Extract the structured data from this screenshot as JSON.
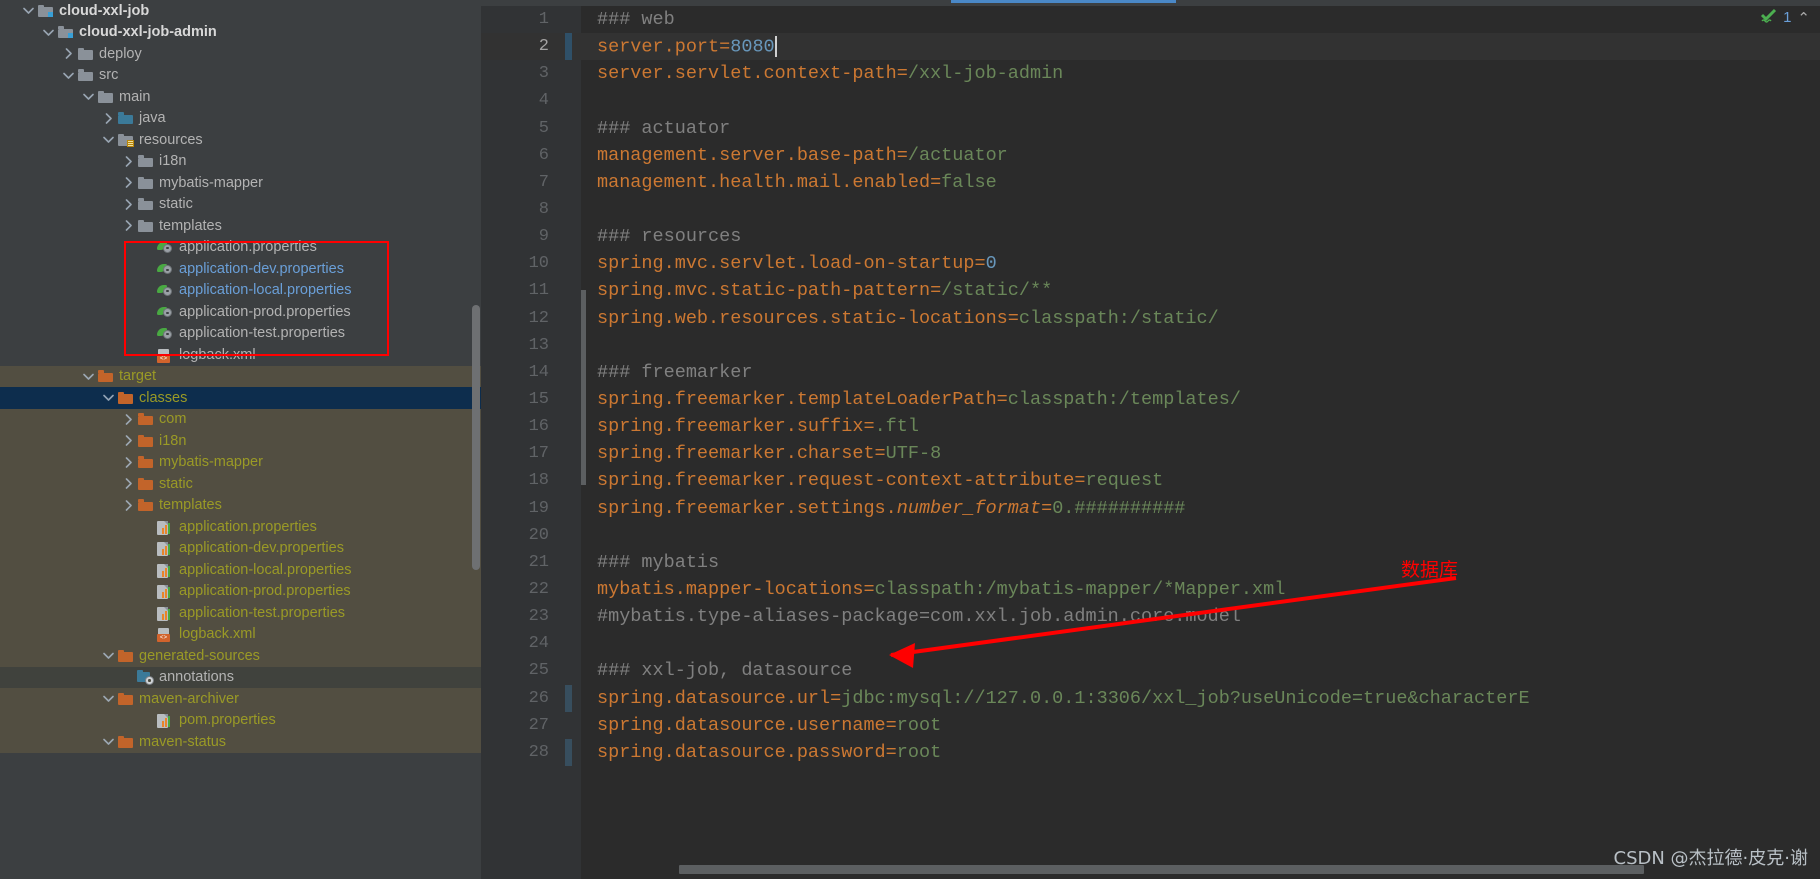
{
  "sidebar": {
    "scrollbar_label": "project-tree-scrollbar",
    "items": [
      {
        "label": "cloud-xxl-job",
        "indent": 0,
        "arrow": "down",
        "icon": "module-folder-icon",
        "style": "bold",
        "state": "normal"
      },
      {
        "label": "cloud-xxl-job-admin",
        "indent": 1,
        "arrow": "down",
        "icon": "module-folder-icon",
        "style": "bold",
        "state": "normal"
      },
      {
        "label": "deploy",
        "indent": 2,
        "arrow": "right",
        "icon": "folder-icon",
        "style": "grey",
        "state": "normal"
      },
      {
        "label": "src",
        "indent": 2,
        "arrow": "down",
        "icon": "folder-icon",
        "style": "grey",
        "state": "normal"
      },
      {
        "label": "main",
        "indent": 3,
        "arrow": "down",
        "icon": "folder-icon",
        "style": "grey",
        "state": "normal"
      },
      {
        "label": "java",
        "indent": 4,
        "arrow": "right",
        "icon": "source-folder-icon",
        "style": "grey",
        "state": "normal"
      },
      {
        "label": "resources",
        "indent": 4,
        "arrow": "down",
        "icon": "resources-folder-icon",
        "style": "grey",
        "state": "normal"
      },
      {
        "label": "i18n",
        "indent": 5,
        "arrow": "right",
        "icon": "folder-icon",
        "style": "grey",
        "state": "normal"
      },
      {
        "label": "mybatis-mapper",
        "indent": 5,
        "arrow": "right",
        "icon": "folder-icon",
        "style": "grey",
        "state": "normal"
      },
      {
        "label": "static",
        "indent": 5,
        "arrow": "right",
        "icon": "folder-icon",
        "style": "grey",
        "state": "normal"
      },
      {
        "label": "templates",
        "indent": 5,
        "arrow": "right",
        "icon": "folder-icon",
        "style": "grey",
        "state": "normal"
      },
      {
        "label": "application.properties",
        "indent": 6,
        "arrow": "none",
        "icon": "spring-properties-icon",
        "style": "grey",
        "state": "normal"
      },
      {
        "label": "application-dev.properties",
        "indent": 6,
        "arrow": "none",
        "icon": "spring-properties-icon",
        "style": "blue",
        "state": "normal"
      },
      {
        "label": "application-local.properties",
        "indent": 6,
        "arrow": "none",
        "icon": "spring-properties-icon",
        "style": "blue",
        "state": "normal"
      },
      {
        "label": "application-prod.properties",
        "indent": 6,
        "arrow": "none",
        "icon": "spring-properties-icon",
        "style": "grey",
        "state": "normal"
      },
      {
        "label": "application-test.properties",
        "indent": 6,
        "arrow": "none",
        "icon": "spring-properties-icon",
        "style": "grey",
        "state": "normal"
      },
      {
        "label": "logback.xml",
        "indent": 6,
        "arrow": "none",
        "icon": "xml-file-icon",
        "style": "grey",
        "state": "normal"
      },
      {
        "label": "target",
        "indent": 3,
        "arrow": "down",
        "icon": "orange-folder-icon",
        "style": "olive",
        "state": "excluded"
      },
      {
        "label": "classes",
        "indent": 4,
        "arrow": "down",
        "icon": "orange-folder-icon",
        "style": "olive",
        "state": "selected-dark"
      },
      {
        "label": "com",
        "indent": 5,
        "arrow": "right",
        "icon": "orange-folder-icon",
        "style": "olive",
        "state": "excluded"
      },
      {
        "label": "i18n",
        "indent": 5,
        "arrow": "right",
        "icon": "orange-folder-icon",
        "style": "olive",
        "state": "excluded"
      },
      {
        "label": "mybatis-mapper",
        "indent": 5,
        "arrow": "right",
        "icon": "orange-folder-icon",
        "style": "olive",
        "state": "excluded"
      },
      {
        "label": "static",
        "indent": 5,
        "arrow": "right",
        "icon": "orange-folder-icon",
        "style": "olive",
        "state": "excluded"
      },
      {
        "label": "templates",
        "indent": 5,
        "arrow": "right",
        "icon": "orange-folder-icon",
        "style": "olive",
        "state": "excluded"
      },
      {
        "label": "application.properties",
        "indent": 6,
        "arrow": "none",
        "icon": "properties-file-icon",
        "style": "olive",
        "state": "excluded"
      },
      {
        "label": "application-dev.properties",
        "indent": 6,
        "arrow": "none",
        "icon": "properties-file-icon",
        "style": "olive",
        "state": "excluded"
      },
      {
        "label": "application-local.properties",
        "indent": 6,
        "arrow": "none",
        "icon": "properties-file-icon",
        "style": "olive",
        "state": "excluded"
      },
      {
        "label": "application-prod.properties",
        "indent": 6,
        "arrow": "none",
        "icon": "properties-file-icon",
        "style": "olive",
        "state": "excluded"
      },
      {
        "label": "application-test.properties",
        "indent": 6,
        "arrow": "none",
        "icon": "properties-file-icon",
        "style": "olive",
        "state": "excluded"
      },
      {
        "label": "logback.xml",
        "indent": 6,
        "arrow": "none",
        "icon": "xml-file-icon",
        "style": "olive",
        "state": "excluded"
      },
      {
        "label": "generated-sources",
        "indent": 4,
        "arrow": "down",
        "icon": "orange-folder-icon",
        "style": "olive",
        "state": "excluded"
      },
      {
        "label": "annotations",
        "indent": 5,
        "arrow": "none",
        "icon": "annotations-folder-icon",
        "style": "grey",
        "state": "selected-grey"
      },
      {
        "label": "maven-archiver",
        "indent": 4,
        "arrow": "down",
        "icon": "orange-folder-icon",
        "style": "olive",
        "state": "excluded"
      },
      {
        "label": "pom.properties",
        "indent": 6,
        "arrow": "none",
        "icon": "properties-file-icon",
        "style": "olive",
        "state": "excluded"
      },
      {
        "label": "maven-status",
        "indent": 4,
        "arrow": "down",
        "icon": "orange-folder-icon",
        "style": "olive",
        "state": "excluded"
      }
    ]
  },
  "editor": {
    "inspection": {
      "status_icon": "green-check-icon",
      "count": "1",
      "chevron": "⌃"
    },
    "lines": [
      {
        "n": "1",
        "marker": "none",
        "current": false,
        "tokens": [
          {
            "t": "### web",
            "c": "com"
          }
        ]
      },
      {
        "n": "2",
        "marker": "cursor",
        "current": true,
        "tokens": [
          {
            "t": "server.port",
            "c": "key"
          },
          {
            "t": "=",
            "c": "eq"
          },
          {
            "t": "8080",
            "c": "num"
          }
        ]
      },
      {
        "n": "3",
        "marker": "none",
        "current": false,
        "tokens": [
          {
            "t": "server.servlet.context-path",
            "c": "key"
          },
          {
            "t": "=",
            "c": "eq"
          },
          {
            "t": "/xxl-job-admin",
            "c": "val"
          }
        ]
      },
      {
        "n": "4",
        "marker": "none",
        "current": false,
        "tokens": []
      },
      {
        "n": "5",
        "marker": "none",
        "current": false,
        "tokens": [
          {
            "t": "### actuator",
            "c": "com"
          }
        ]
      },
      {
        "n": "6",
        "marker": "none",
        "current": false,
        "tokens": [
          {
            "t": "management.server.base-path",
            "c": "key"
          },
          {
            "t": "=",
            "c": "eq"
          },
          {
            "t": "/actuator",
            "c": "val"
          }
        ]
      },
      {
        "n": "7",
        "marker": "none",
        "current": false,
        "tokens": [
          {
            "t": "management.health.mail.enabled",
            "c": "key"
          },
          {
            "t": "=",
            "c": "eq"
          },
          {
            "t": "false",
            "c": "val"
          }
        ]
      },
      {
        "n": "8",
        "marker": "none",
        "current": false,
        "tokens": []
      },
      {
        "n": "9",
        "marker": "none",
        "current": false,
        "tokens": [
          {
            "t": "### resources",
            "c": "com"
          }
        ]
      },
      {
        "n": "10",
        "marker": "none",
        "current": false,
        "tokens": [
          {
            "t": "spring.mvc.servlet.load-on-startup",
            "c": "key"
          },
          {
            "t": "=",
            "c": "eq"
          },
          {
            "t": "0",
            "c": "num"
          }
        ]
      },
      {
        "n": "11",
        "marker": "none",
        "current": false,
        "tokens": [
          {
            "t": "spring.mvc.static-path-pattern",
            "c": "key"
          },
          {
            "t": "=",
            "c": "eq"
          },
          {
            "t": "/static/**",
            "c": "val"
          }
        ]
      },
      {
        "n": "12",
        "marker": "none",
        "current": false,
        "tokens": [
          {
            "t": "spring.web.resources.static-locations",
            "c": "key"
          },
          {
            "t": "=",
            "c": "eq"
          },
          {
            "t": "classpath:/static/",
            "c": "val"
          }
        ]
      },
      {
        "n": "13",
        "marker": "none",
        "current": false,
        "tokens": []
      },
      {
        "n": "14",
        "marker": "none",
        "current": false,
        "tokens": [
          {
            "t": "### freemarker",
            "c": "com"
          }
        ]
      },
      {
        "n": "15",
        "marker": "none",
        "current": false,
        "tokens": [
          {
            "t": "spring.freemarker.templateLoaderPath",
            "c": "key"
          },
          {
            "t": "=",
            "c": "eq"
          },
          {
            "t": "classpath:/templates/",
            "c": "val"
          }
        ]
      },
      {
        "n": "16",
        "marker": "none",
        "current": false,
        "tokens": [
          {
            "t": "spring.freemarker.suffix",
            "c": "key"
          },
          {
            "t": "=",
            "c": "eq"
          },
          {
            "t": ".ftl",
            "c": "val"
          }
        ]
      },
      {
        "n": "17",
        "marker": "none",
        "current": false,
        "tokens": [
          {
            "t": "spring.freemarker.charset",
            "c": "key"
          },
          {
            "t": "=",
            "c": "eq"
          },
          {
            "t": "UTF-8",
            "c": "val"
          }
        ]
      },
      {
        "n": "18",
        "marker": "none",
        "current": false,
        "tokens": [
          {
            "t": "spring.freemarker.request-context-attribute",
            "c": "key"
          },
          {
            "t": "=",
            "c": "eq"
          },
          {
            "t": "request",
            "c": "val"
          }
        ]
      },
      {
        "n": "19",
        "marker": "none",
        "current": false,
        "tokens": [
          {
            "t": "spring.freemarker.settings.",
            "c": "key"
          },
          {
            "t": "number_format",
            "c": "it"
          },
          {
            "t": "=",
            "c": "eq"
          },
          {
            "t": "0.##########",
            "c": "val"
          }
        ]
      },
      {
        "n": "20",
        "marker": "none",
        "current": false,
        "tokens": []
      },
      {
        "n": "21",
        "marker": "none",
        "current": false,
        "tokens": [
          {
            "t": "### mybatis",
            "c": "com"
          }
        ]
      },
      {
        "n": "22",
        "marker": "none",
        "current": false,
        "tokens": [
          {
            "t": "mybatis.mapper-locations",
            "c": "key"
          },
          {
            "t": "=",
            "c": "eq"
          },
          {
            "t": "classpath:/mybatis-mapper/*Mapper.xml",
            "c": "val"
          }
        ]
      },
      {
        "n": "23",
        "marker": "none",
        "current": false,
        "tokens": [
          {
            "t": "#mybatis.type-aliases-package=com.xxl.job.admin.core.model",
            "c": "com"
          }
        ]
      },
      {
        "n": "24",
        "marker": "none",
        "current": false,
        "tokens": []
      },
      {
        "n": "25",
        "marker": "none",
        "current": false,
        "tokens": [
          {
            "t": "### xxl-job, datasource",
            "c": "com"
          }
        ]
      },
      {
        "n": "26",
        "marker": "change",
        "current": false,
        "tokens": [
          {
            "t": "spring.datasource.url",
            "c": "key"
          },
          {
            "t": "=",
            "c": "eq"
          },
          {
            "t": "jdbc:mysql://127.0.0.1:3306/xxl_job?useUnicode=true&characterE",
            "c": "val"
          }
        ]
      },
      {
        "n": "27",
        "marker": "none",
        "current": false,
        "tokens": [
          {
            "t": "spring.datasource.username",
            "c": "key"
          },
          {
            "t": "=",
            "c": "eq"
          },
          {
            "t": "root",
            "c": "val"
          }
        ]
      },
      {
        "n": "28",
        "marker": "change",
        "current": false,
        "tokens": [
          {
            "t": "spring.datasource.password",
            "c": "key"
          },
          {
            "t": "=",
            "c": "eq"
          },
          {
            "t": "root",
            "c": "val"
          }
        ]
      }
    ]
  },
  "annotations": {
    "callout_text": "数据库",
    "callout_color": "#ff0000",
    "highlight_box_color": "#ff0000"
  },
  "watermark": {
    "text": "CSDN @杰拉德·皮克·谢"
  }
}
